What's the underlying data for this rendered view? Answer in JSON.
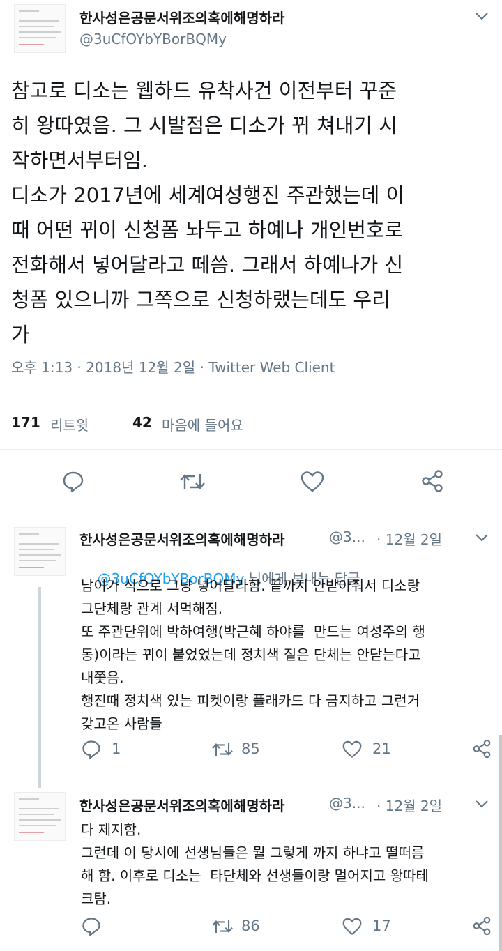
{
  "main_tweet": {
    "author_name": "한사성은공문서위조의혹에해명하라",
    "author_handle": "@3uCfOYbYBorBQMy",
    "lines": [
      "참고로 디소는 웹하드 유착사건 이전부터 꾸준",
      "히 왕따였음. 그 시발점은 디소가 뀌 쳐내기 시",
      "작하면서부터임.",
      "디소가 2017년에 세계여성행진 주관했는데 이",
      "때 어떤 뀌이 신청폼 놔두고 하예나 개인번호로",
      "전화해서 넣어달라고 떼씀. 그래서 하예나가 신",
      "청폼 있으니까 그쪽으로 신청하랬는데도 우리",
      "가"
    ],
    "timestamp": "오후 1:13 · 2018년 12월 2일 · Twitter Web Client",
    "retweet_count": "171",
    "retweet_label": "리트윗",
    "like_count": "42",
    "like_label": "마음에 들어요"
  },
  "replies": [
    {
      "author_name": "한사성은공문서위조의혹에해명하라",
      "author_handle": "@3...",
      "date": "· 12월 2일",
      "reply_to_handle": "@3uCfOYbYBorBQMy",
      "reply_to_suffix": "님에게 보내는 답글",
      "lines": [
        "남이가 식으로 그냥 넣어달라함. 끝까지 안받아줘서 디소랑",
        "그단체랑 관계 서먹해짐.",
        "또 주관단위에 박하여행(박근혜 하야를  만드는 여성주의 행",
        "동)이라는 뀌이 붙었었는데 정치색 짙은 단체는 안닫는다고",
        "내쫓음.",
        "행진때 정치색 있는 피켓이랑 플래카드 다 금지하고 그런거",
        "갖고온 사람들"
      ],
      "reply_count": "1",
      "retweet_count": "85",
      "like_count": "21"
    },
    {
      "author_name": "한사성은공문서위조의혹에해명하라",
      "author_handle": "@3...",
      "date": "· 12월 2일",
      "lines": [
        "다 제지함.",
        "그런데 이 당시에 선생님들은 뭘 그렇게 까지 하냐고 떨떠름",
        "해 함. 이후로 디소는  타단체와 선생들이랑 멀어지고 왕따테",
        "크탐."
      ],
      "reply_count": "",
      "retweet_count": "86",
      "like_count": "17"
    }
  ],
  "colors": {
    "accent": "#1da1f2",
    "secondary_text": "#657786",
    "text": "#14171a"
  },
  "icons": [
    "chevron-down-icon",
    "reply-icon",
    "retweet-icon",
    "like-icon",
    "share-icon"
  ]
}
